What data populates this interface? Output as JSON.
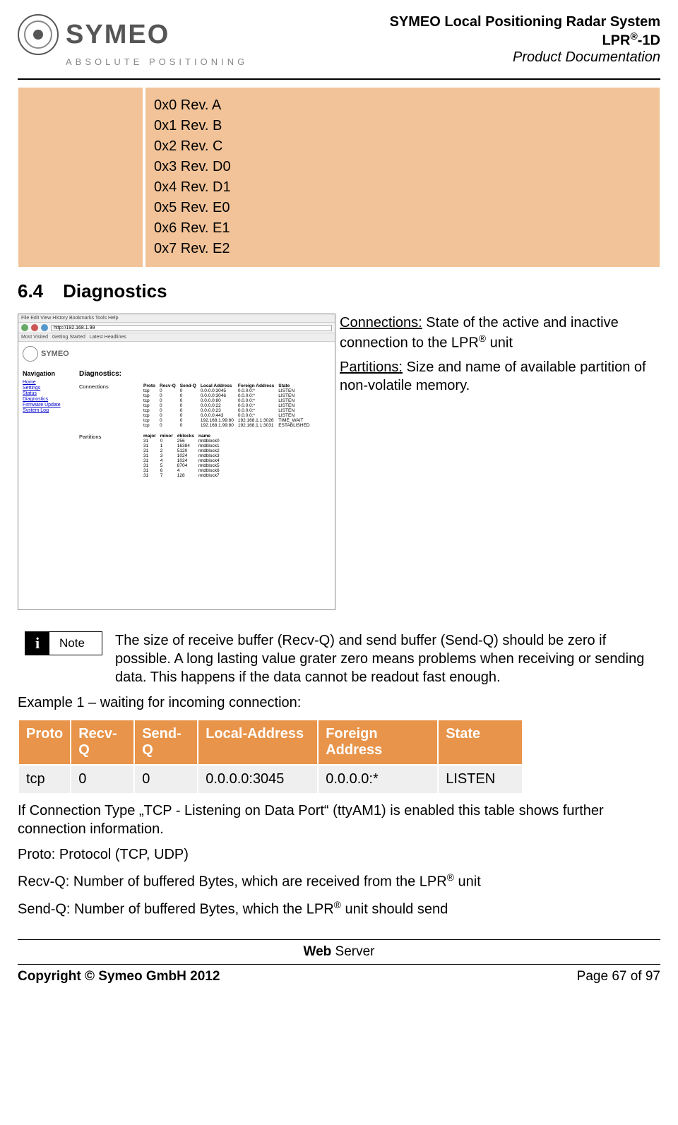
{
  "header": {
    "logo_text": "SYMEO",
    "logo_sub": "ABSOLUTE POSITIONING",
    "line1": "SYMEO Local Positioning Radar System",
    "line2_pre": "LPR",
    "line2_sup": "®",
    "line2_post": "-1D",
    "line3": "Product Documentation"
  },
  "rev_list": [
    "0x0 Rev. A",
    "0x1 Rev. B",
    "0x2 Rev. C",
    "0x3 Rev. D0",
    "0x4 Rev. D1",
    "0x5 Rev. E0",
    "0x6 Rev. E1",
    "0x7 Rev. E2"
  ],
  "section": {
    "num": "6.4",
    "title": "Diagnostics"
  },
  "diag": {
    "conn_label": "Connections:",
    "conn_text_a": " State of the active and inactive connection to the LPR",
    "conn_sup": "®",
    "conn_text_b": " unit",
    "part_label": "Partitions:",
    "part_text": " Size and name of available partition of non-volatile memory."
  },
  "screenshot": {
    "menu": "File  Edit  View  History  Bookmarks  Tools  Help",
    "url": "http://192.168.1.99",
    "nav_title": "Navigation",
    "nav_items": [
      "Home",
      "Settings",
      "Status",
      "Diagnostics",
      "Firmware Update",
      "System Log"
    ],
    "main_title": "Diagnostics:",
    "conn_label": "Connections",
    "part_label": "Partitions",
    "conn_head": [
      "Proto",
      "Recv-Q",
      "Send-Q",
      "Local Address",
      "Foreign Address",
      "State"
    ],
    "conn_rows": [
      [
        "tcp",
        "0",
        "0",
        "0.0.0.0:3045",
        "0.0.0.0:*",
        "LISTEN"
      ],
      [
        "tcp",
        "0",
        "0",
        "0.0.0.0:3046",
        "0.0.0.0:*",
        "LISTEN"
      ],
      [
        "tcp",
        "0",
        "0",
        "0.0.0.0:80",
        "0.0.0.0:*",
        "LISTEN"
      ],
      [
        "tcp",
        "0",
        "0",
        "0.0.0.0:22",
        "0.0.0.0:*",
        "LISTEN"
      ],
      [
        "tcp",
        "0",
        "0",
        "0.0.0.0:23",
        "0.0.0.0:*",
        "LISTEN"
      ],
      [
        "tcp",
        "0",
        "0",
        "0.0.0.0:443",
        "0.0.0.0:*",
        "LISTEN"
      ],
      [
        "tcp",
        "0",
        "0",
        "192.168.1.99:80",
        "192.168.1.1:3026",
        "TIME_WAIT"
      ],
      [
        "tcp",
        "0",
        "0",
        "192.168.1.99:80",
        "192.168.1.1:3031",
        "ESTABLISHED"
      ]
    ],
    "part_head": [
      "major",
      "minor",
      "#blocks",
      "name"
    ],
    "part_rows": [
      [
        "31",
        "0",
        "256",
        "mtdblock0"
      ],
      [
        "31",
        "1",
        "16384",
        "mtdblock1"
      ],
      [
        "31",
        "2",
        "5120",
        "mtdblock2"
      ],
      [
        "31",
        "3",
        "1024",
        "mtdblock3"
      ],
      [
        "31",
        "4",
        "1024",
        "mtdblock4"
      ],
      [
        "31",
        "5",
        "8704",
        "mtdblock5"
      ],
      [
        "31",
        "6",
        "4",
        "mtdblock6"
      ],
      [
        "31",
        "7",
        "128",
        "mtdblock7"
      ]
    ]
  },
  "note": {
    "badge": "Note",
    "text": "The size of receive buffer (Recv-Q) and send buffer (Send-Q) should be zero if possible. A long lasting value grater zero means problems when receiving or sending data. This happens if the data cannot be readout fast enough."
  },
  "example_caption": "Example 1 – waiting for incoming connection:",
  "proto_table": {
    "headers": [
      "Proto",
      "Recv-Q",
      "Send-Q",
      "Local-Address",
      "Foreign Address",
      "State"
    ],
    "row": [
      "tcp",
      "0",
      "0",
      "0.0.0.0:3045",
      "0.0.0.0:*",
      "LISTEN"
    ]
  },
  "after_table": {
    "p1": "If Connection Type „TCP - Listening on Data Port“ (ttyAM1) is enabled this table shows further connection information.",
    "p2": "Proto: Protocol (TCP, UDP)",
    "p3a": "Recv-Q: Number of buffered Bytes, which are received from the LPR",
    "p3sup": "®",
    "p3b": " unit",
    "p4a": "Send-Q: Number of buffered Bytes, which the LPR",
    "p4sup": "®",
    "p4b": " unit should send"
  },
  "footer": {
    "center_bold": "Web",
    "center_rest": " Server",
    "copyright": "Copyright © Symeo GmbH 2012",
    "page": "Page 67 of 97"
  }
}
